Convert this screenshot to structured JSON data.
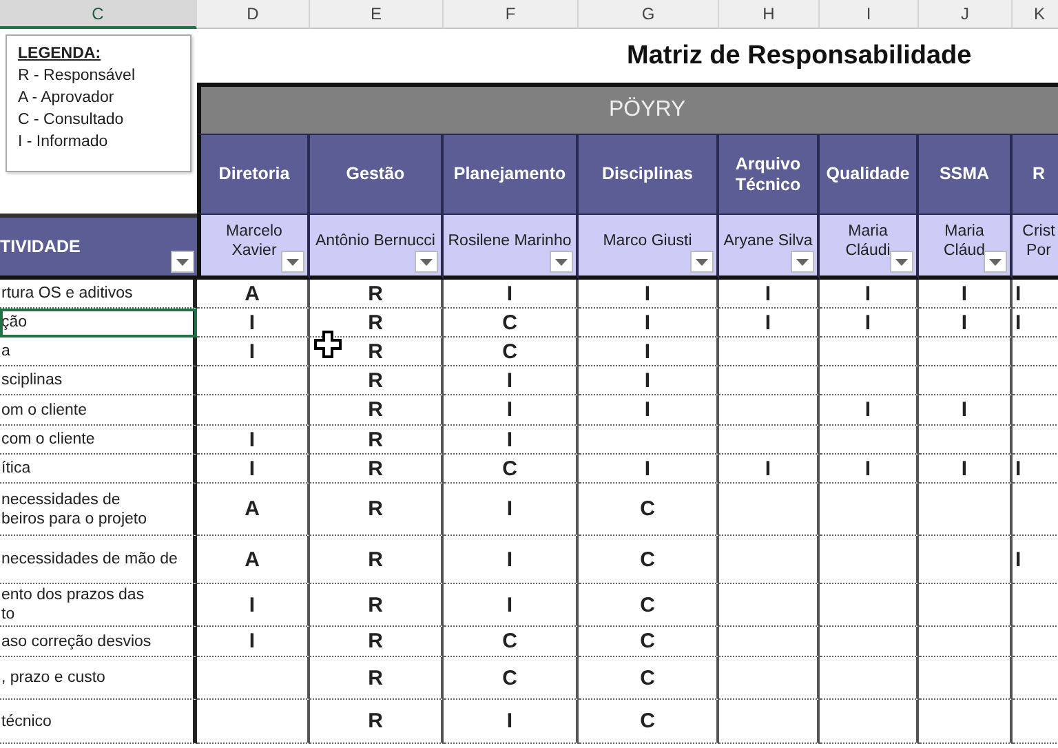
{
  "column_letters": [
    {
      "label": "C",
      "selected": true
    },
    {
      "label": "D",
      "selected": false
    },
    {
      "label": "E",
      "selected": false
    },
    {
      "label": "F",
      "selected": false
    },
    {
      "label": "G",
      "selected": false
    },
    {
      "label": "H",
      "selected": false
    },
    {
      "label": "I",
      "selected": false
    },
    {
      "label": "J",
      "selected": false
    },
    {
      "label": "K",
      "selected": false
    }
  ],
  "legend": {
    "title": "LEGENDA:",
    "items": [
      "R - Responsável",
      "A - Aprovador",
      "C - Consultado",
      "I - Informado"
    ]
  },
  "title": "Matriz de Responsabilidade",
  "company": "PÖYRY",
  "activity_header": "TIVIDADE",
  "departments": [
    "Diretoria",
    "Gestão",
    "Planejamento",
    "Disciplinas",
    "Arquivo\nTécnico",
    "Qualidade",
    "SSMA",
    "R"
  ],
  "people": [
    "Marcelo\nXavier",
    "Antônio Bernucci",
    "Rosilene Marinho",
    "Marco Giusti",
    "Aryane Silva",
    "Maria\nCláudi",
    "Maria\nCláud",
    "Crist\nPor"
  ],
  "rows": [
    {
      "activity": "rtura OS e aditivos",
      "selected": false,
      "cells": [
        "A",
        "R",
        "I",
        "I",
        "I",
        "I",
        "I",
        "I"
      ]
    },
    {
      "activity": "ção",
      "selected": true,
      "cells": [
        "I",
        "R",
        "C",
        "I",
        "I",
        "I",
        "I",
        "I"
      ]
    },
    {
      "activity": "a",
      "selected": false,
      "cells": [
        "I",
        "R",
        "C",
        "I",
        "",
        "",
        "",
        ""
      ]
    },
    {
      "activity": "sciplinas",
      "selected": false,
      "cells": [
        "",
        "R",
        "I",
        "I",
        "",
        "",
        "",
        ""
      ]
    },
    {
      "activity": "om o cliente",
      "selected": false,
      "cells": [
        "",
        "R",
        "I",
        "I",
        "",
        "I",
        "I",
        ""
      ]
    },
    {
      "activity": "com o cliente",
      "selected": false,
      "cells": [
        "I",
        "R",
        "I",
        "",
        "",
        "",
        "",
        ""
      ]
    },
    {
      "activity": "ítica",
      "selected": false,
      "cells": [
        "I",
        "R",
        "C",
        "I",
        "I",
        "I",
        "I",
        "I"
      ]
    },
    {
      "activity": "necessidades de\nbeiros para o projeto",
      "selected": false,
      "cells": [
        "A",
        "R",
        "I",
        "C",
        "",
        "",
        "",
        ""
      ]
    },
    {
      "activity": "necessidades de mão de",
      "selected": false,
      "cells": [
        "A",
        "R",
        "I",
        "C",
        "",
        "",
        "",
        "I"
      ]
    },
    {
      "activity": "ento dos prazos das\nto",
      "selected": false,
      "cells": [
        "I",
        "R",
        "I",
        "C",
        "",
        "",
        "",
        ""
      ]
    },
    {
      "activity": "aso correção desvios",
      "selected": false,
      "cells": [
        "I",
        "R",
        "C",
        "C",
        "",
        "",
        "",
        ""
      ]
    },
    {
      "activity": ", prazo e custo",
      "selected": false,
      "cells": [
        "",
        "R",
        "C",
        "C",
        "",
        "",
        "",
        ""
      ]
    },
    {
      "activity": "técnico",
      "selected": false,
      "cells": [
        "",
        "R",
        "I",
        "C",
        "",
        "",
        "",
        ""
      ]
    }
  ]
}
